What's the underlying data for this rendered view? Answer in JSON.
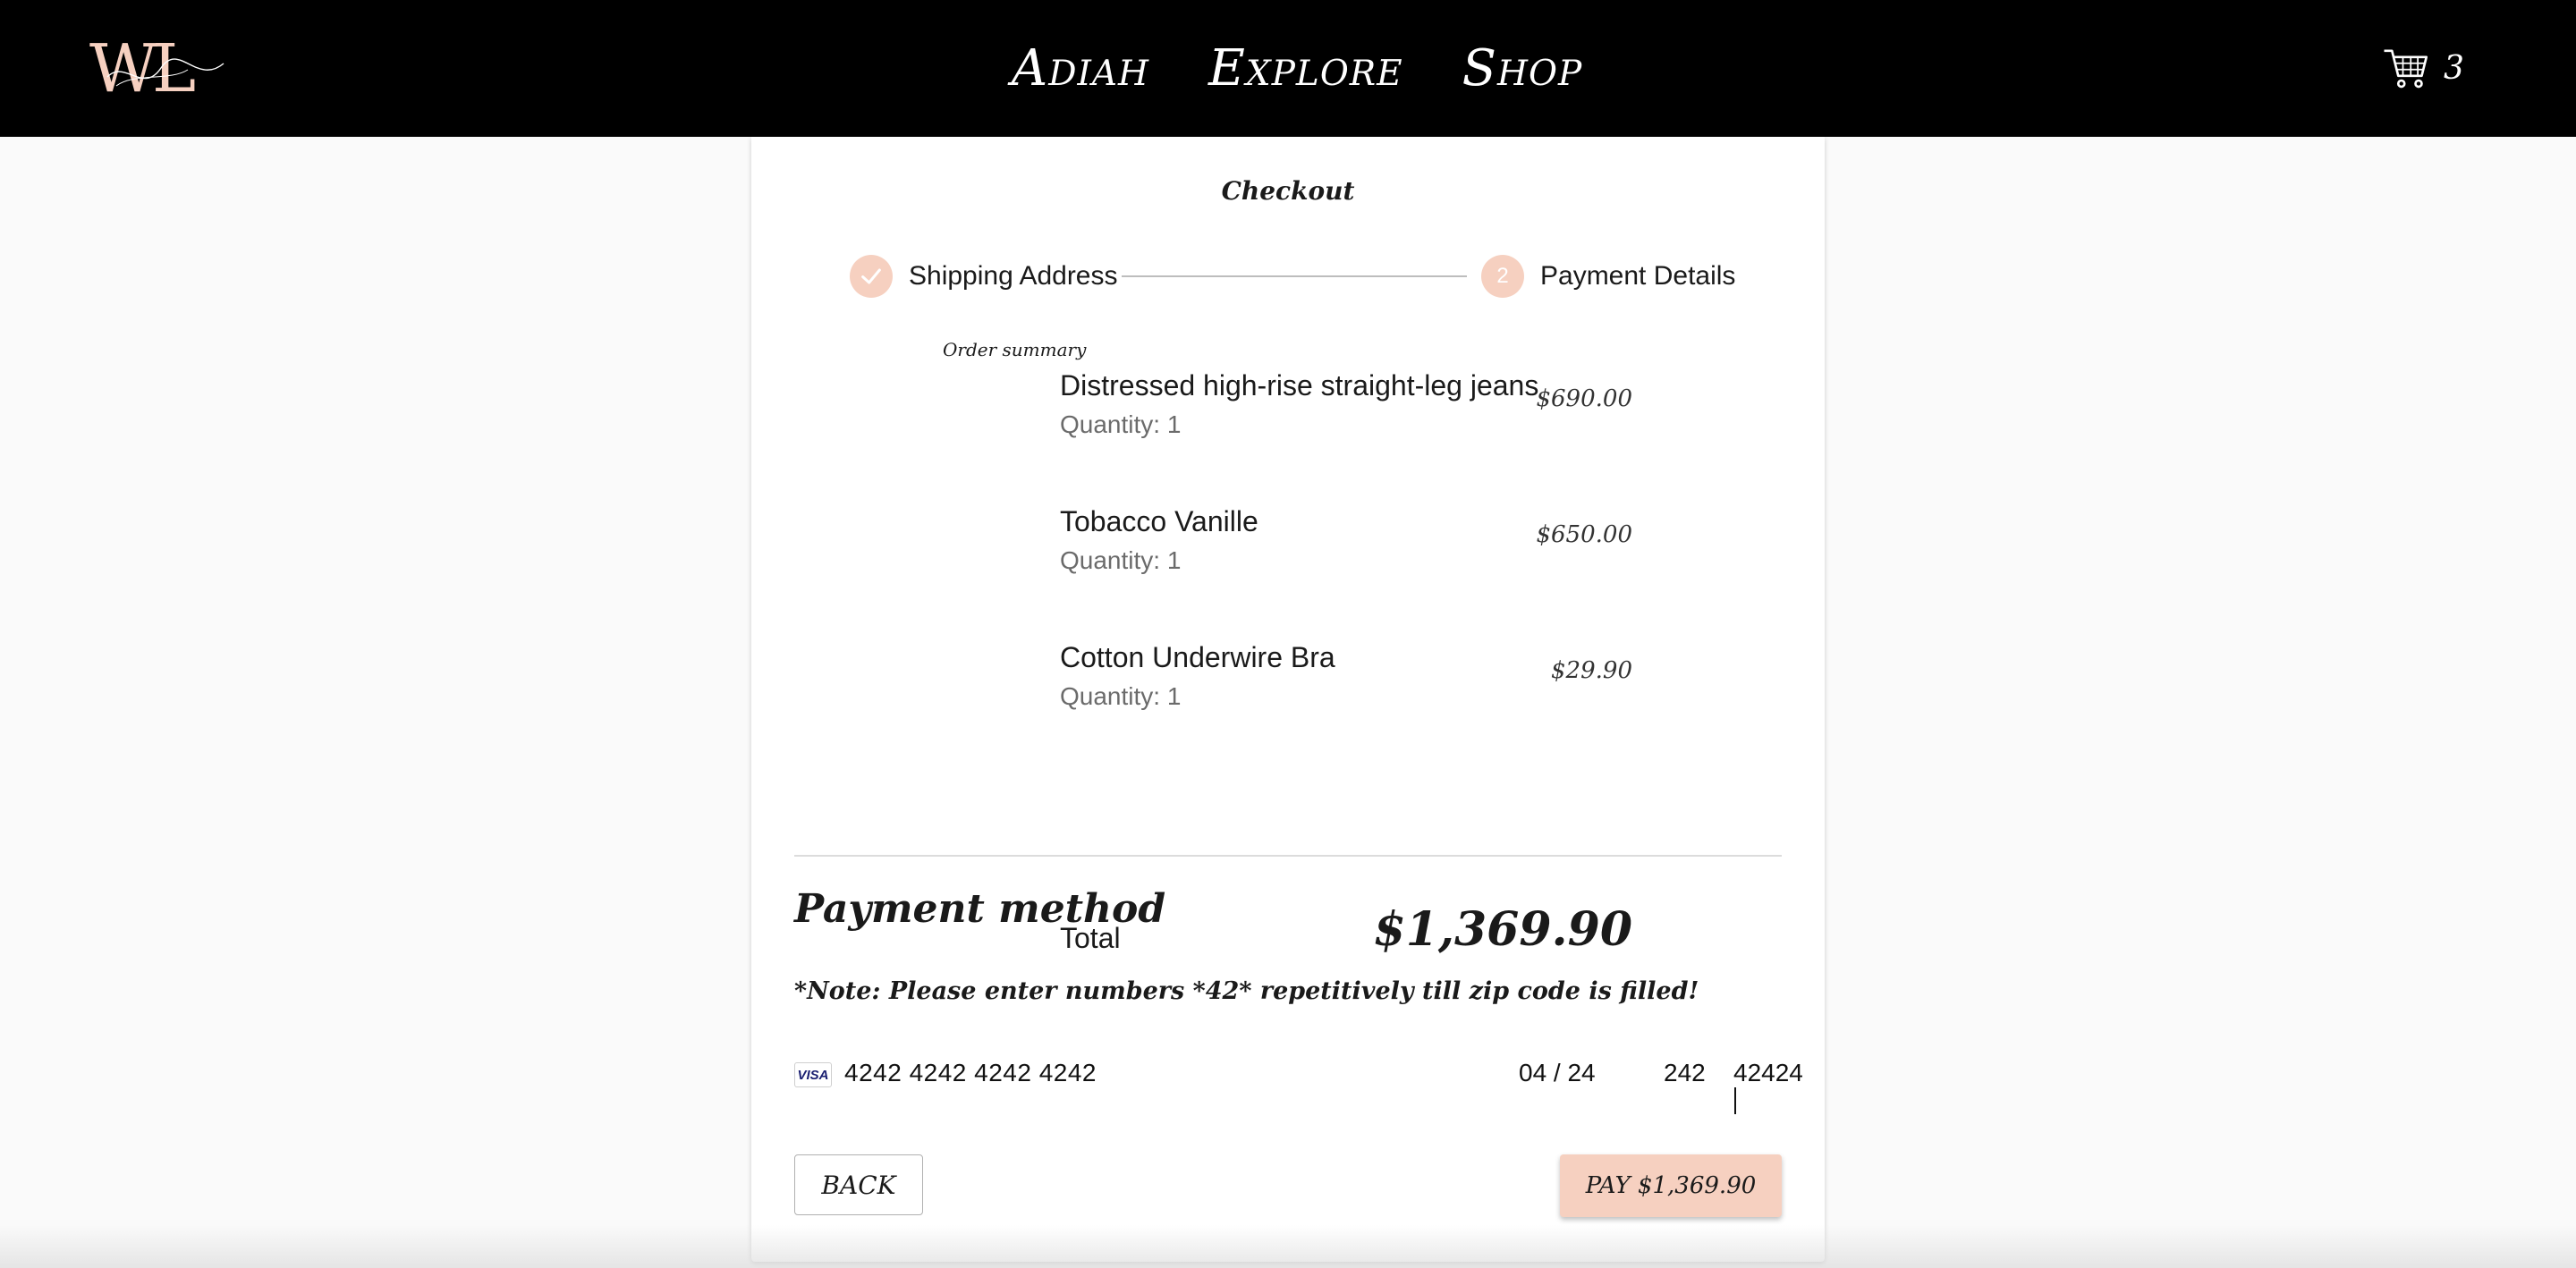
{
  "header": {
    "logo_text": "WL",
    "logo_signature": "Adiah",
    "nav": [
      "Adiah",
      "Explore",
      "Shop"
    ],
    "cart_count": "3",
    "cart_icon": "shopping-cart-icon"
  },
  "checkout": {
    "title": "Checkout",
    "steps": [
      {
        "label": "Shipping Address",
        "state": "completed",
        "icon": "check-icon"
      },
      {
        "number": "2",
        "label": "Payment Details",
        "state": "active"
      }
    ],
    "order_summary_label": "Order summary",
    "items": [
      {
        "name": "Distressed high-rise straight-leg jeans",
        "quantity": "Quantity: 1",
        "price": "$690.00"
      },
      {
        "name": "Tobacco Vanille",
        "quantity": "Quantity: 1",
        "price": "$650.00"
      },
      {
        "name": "Cotton Underwire Bra",
        "quantity": "Quantity: 1",
        "price": "$29.90"
      }
    ],
    "total_label": "Total",
    "total_value": "$1,369.90"
  },
  "payment": {
    "heading": "Payment method",
    "note": "*Note: Please enter numbers *42* repetitively till zip code is filled!",
    "card_brand": "VISA",
    "card_number": "4242 4242 4242 4242",
    "expiry": "04 / 24",
    "cvc": "242",
    "zip": "42424"
  },
  "buttons": {
    "back": "BACK",
    "pay": "PAY $1,369.90"
  },
  "colors": {
    "accent": "#f6d0c0",
    "header_bg": "#000000",
    "page_bg": "#fafafa"
  }
}
